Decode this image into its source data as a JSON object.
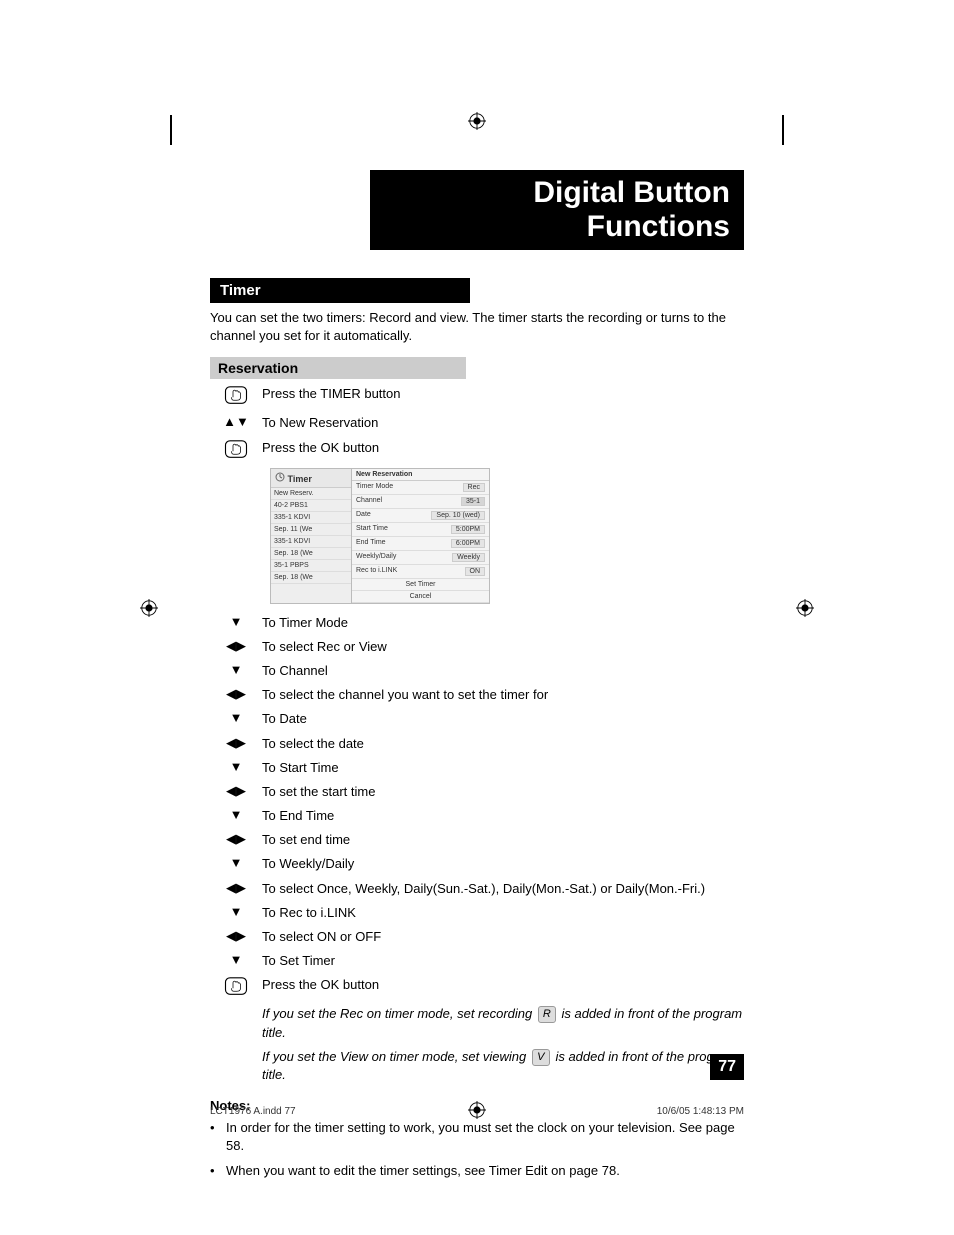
{
  "title": "Digital Button Functions",
  "section": "Timer",
  "intro": "You can set the two timers:  Record and view.  The timer starts the recording or turns to the channel you set for it automatically.",
  "subsection": "Reservation",
  "steps": {
    "press_timer_pre": "Press the T",
    "press_timer_sc": "IMER",
    "press_timer_post": " button",
    "to_new_res": "To New Reservation",
    "press_ok_pre": "Press the O",
    "press_ok_sc": "K",
    "press_ok_post": " button"
  },
  "osd": {
    "left_title": "Timer",
    "left_items": [
      "New Reserv.",
      "40-2  PBS1",
      "335-1  KDVI",
      "Sep. 11 (We",
      "335-1  KDVI",
      "Sep. 18 (We",
      "35-1  PBPS",
      "Sep. 18 (We"
    ],
    "right_title": "New Reservation",
    "rows": [
      {
        "label": "Timer Mode",
        "value": "Rec"
      },
      {
        "label": "Channel",
        "value": "35-1"
      },
      {
        "label": "Date",
        "value": "Sep. 10 (wed)"
      },
      {
        "label": "Start Time",
        "value": "5:00PM"
      },
      {
        "label": "End Time",
        "value": "6:00PM"
      },
      {
        "label": "Weekly/Daily",
        "value": "Weekly"
      },
      {
        "label": "Rec to i.LINK",
        "value": "ON"
      }
    ],
    "set_timer": "Set Timer",
    "cancel": "Cancel"
  },
  "nav": [
    {
      "icon": "down",
      "text": "To Timer Mode"
    },
    {
      "icon": "lr",
      "text": "To select Rec or View"
    },
    {
      "icon": "down",
      "text": "To Channel"
    },
    {
      "icon": "lr",
      "text": "To select the channel you want to set the timer for"
    },
    {
      "icon": "down",
      "text": "To Date"
    },
    {
      "icon": "lr",
      "text": "To select the date"
    },
    {
      "icon": "down",
      "text": "To Start Time"
    },
    {
      "icon": "lr",
      "text": "To set the start time"
    },
    {
      "icon": "down",
      "text": "To End Time"
    },
    {
      "icon": "lr",
      "text": "To set end time"
    },
    {
      "icon": "down",
      "text": "To Weekly/Daily"
    },
    {
      "icon": "lr",
      "text": "To select Once, Weekly, Daily(Sun.-Sat.), Daily(Mon.-Sat.) or Daily(Mon.-Fri.)"
    },
    {
      "icon": "down",
      "text": "To Rec to i.LINK"
    },
    {
      "icon": "lr",
      "text": "To select ON or OFF"
    },
    {
      "icon": "down",
      "text": "To Set Timer"
    },
    {
      "icon": "hand",
      "text": "Press the OK button"
    }
  ],
  "italic1_pre": "If you set the Rec on timer mode, set recording ",
  "italic1_box": "R",
  "italic1_post": " is added in front of the program title.",
  "italic2_pre": "If you set the View on timer mode, set viewing ",
  "italic2_box": "V",
  "italic2_post": " is added in front of the program title.",
  "notes_heading": "Notes:",
  "notes": [
    "In order for the timer setting to work, you must set the clock on your television.  See page 58.",
    "When you want to edit the timer settings, see Timer Edit on page 78."
  ],
  "page_number": "77",
  "footer_left": "LCT1976 A.indd   77",
  "footer_right": "10/6/05   1:48:13 PM"
}
